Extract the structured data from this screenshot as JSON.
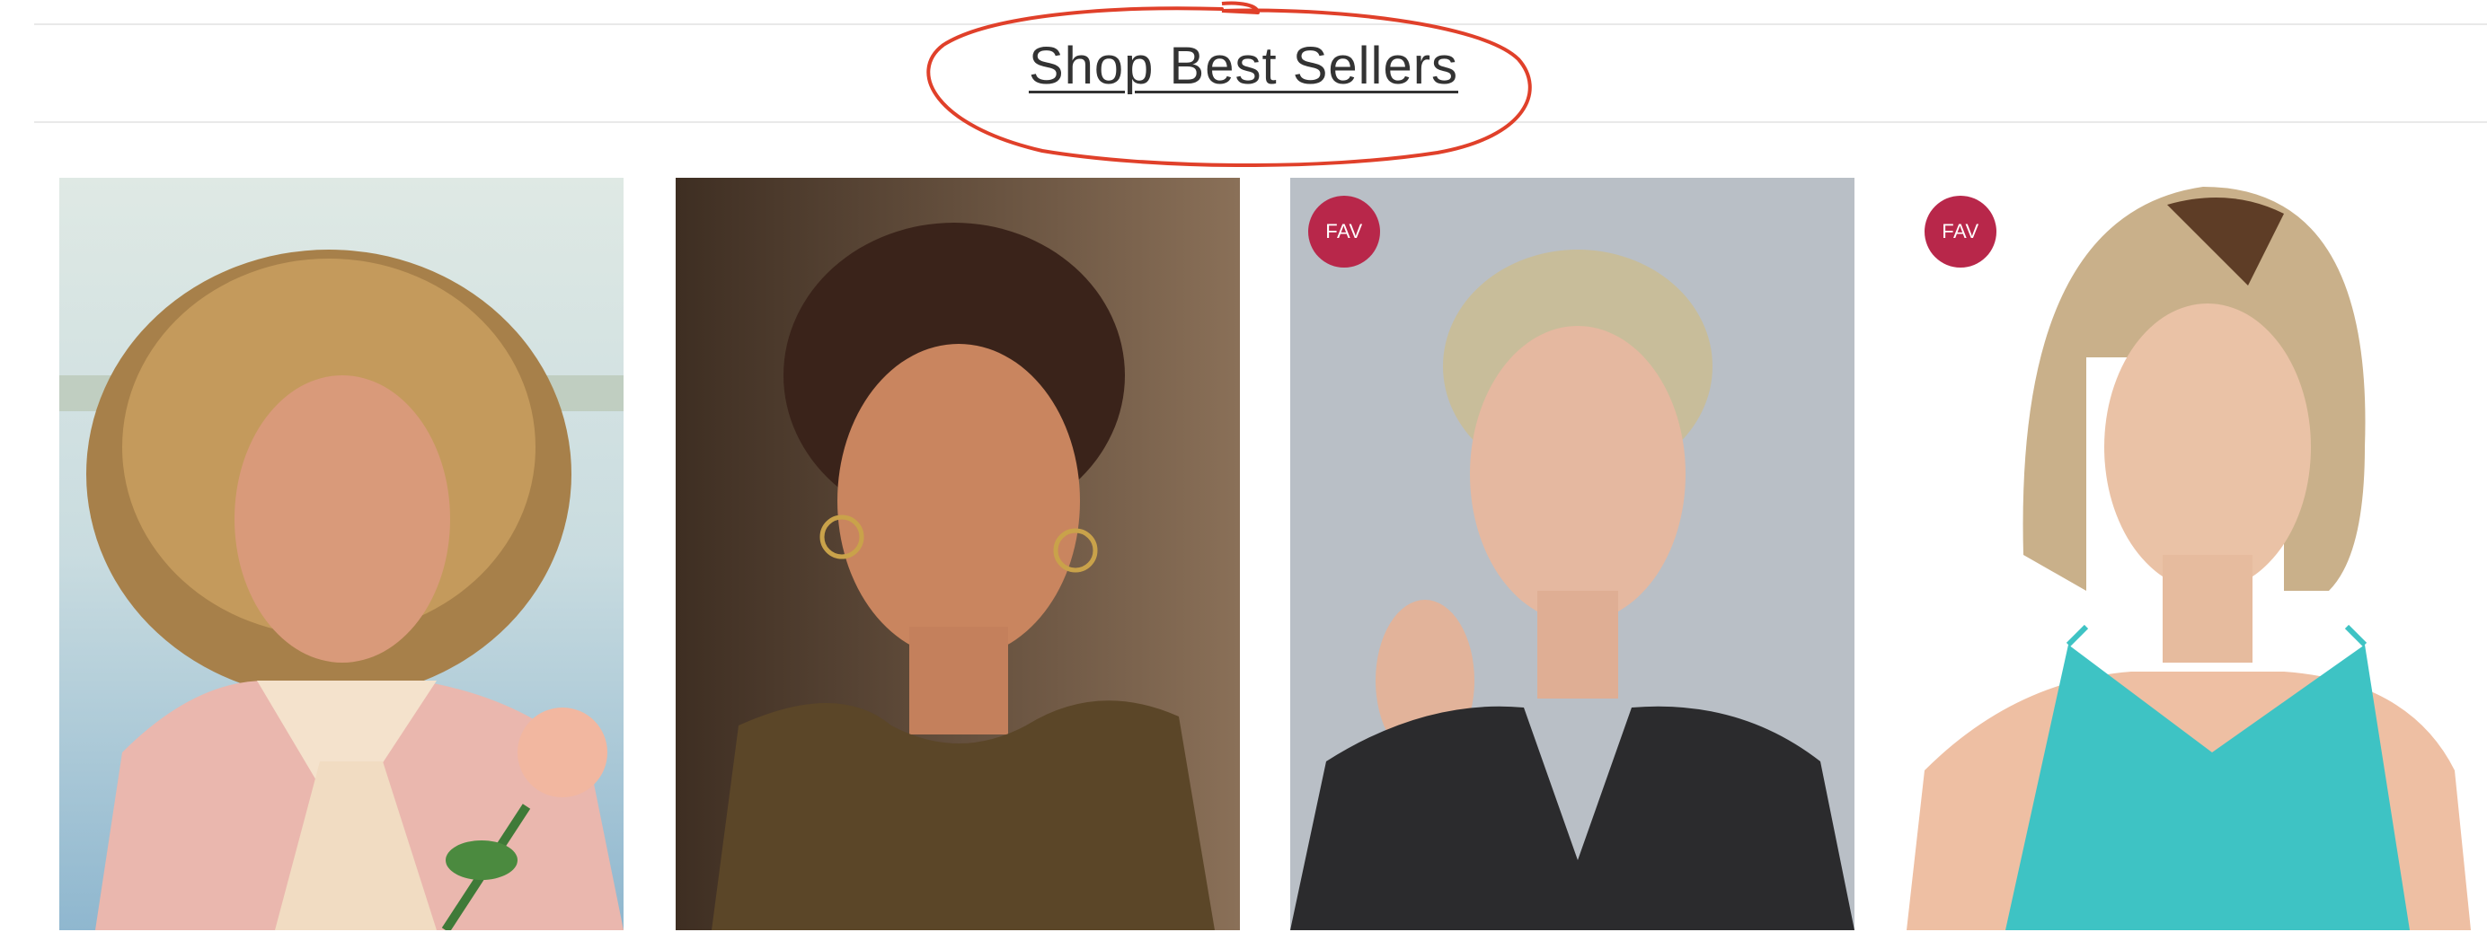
{
  "section": {
    "heading_link": "Shop Best Sellers"
  },
  "products": [
    {
      "image": "woman-with-wavy-blonde-highlighted-hair",
      "badge": ""
    },
    {
      "image": "woman-with-short-dark-brown-pixie-hair",
      "badge": ""
    },
    {
      "image": "woman-with-short-ash-blonde-pixie-hair",
      "badge": "FAV"
    },
    {
      "image": "woman-with-blonde-bob-dark-roots",
      "badge": "FAV"
    }
  ],
  "colors": {
    "badge": "#b8274a",
    "annotation": "#e0402a",
    "heading_text": "#333333",
    "divider": "#e9e9e9"
  }
}
